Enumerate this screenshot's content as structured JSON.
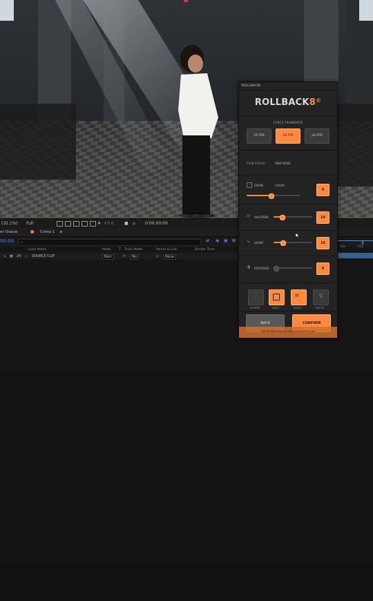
{
  "viewer": {
    "zoom": "(32.1%)",
    "resolution": "Full",
    "exposure": "+0.0",
    "time": "0:00:00:00"
  },
  "timeline": {
    "panel_name": "er Queue",
    "comp_tab": "Comp 1",
    "timecode": "00:00",
    "search_placeholder": "",
    "headers": {
      "layer_name": "Layer Name",
      "mode": "Mode",
      "t": "T",
      "track_matte": "Track Matte",
      "parent_link": "Parent & Link",
      "render_time": "Render Time"
    },
    "layer": {
      "number": "24",
      "name": "SOURCE CLIP",
      "mode": "Norr",
      "track_matte": "No",
      "parent": "None"
    },
    "ruler_labels": [
      "10s",
      "12s"
    ]
  },
  "panel": {
    "tab_title": "ROLLBACK",
    "tab_close": "≡",
    "logo_text": "ROLLBACK",
    "logo_accent": "8",
    "logo_mark": "©",
    "force_framerate_label": "FORCE FRAMERATE",
    "fps_buttons": [
      {
        "label": "12 FPS",
        "active": false
      },
      {
        "label": "18 FPS",
        "active": true
      },
      {
        "label": "24 FPS",
        "active": false
      }
    ],
    "film_stock_label": "FILM STOCK",
    "film_stock_value": "VNR BASE",
    "grain": {
      "label": "GRAIN",
      "sublabel": "COLOR",
      "value": "0",
      "level": 0.45
    },
    "halation": {
      "label": "HALATION",
      "value": "14",
      "level": 0.22
    },
    "shake": {
      "label": "SHAKE",
      "value": "15",
      "level": 0.24
    },
    "exposure": {
      "label": "EXPOSURE",
      "value": "0",
      "level": 0.0
    },
    "modes": [
      {
        "label": "SUPER8",
        "active": false
      },
      {
        "label": "PERFS",
        "active": true
      },
      {
        "label": "EDGES",
        "active": true
      },
      {
        "label": "EXP FIX",
        "active": false
      }
    ],
    "back_label": "BACK",
    "confirm_label": "CONFIRM",
    "footer_note": "FOR OPTIMAL RESULTS, USE IN 23.976 FPS COMP",
    "accent_color": "#ff8a3d"
  }
}
